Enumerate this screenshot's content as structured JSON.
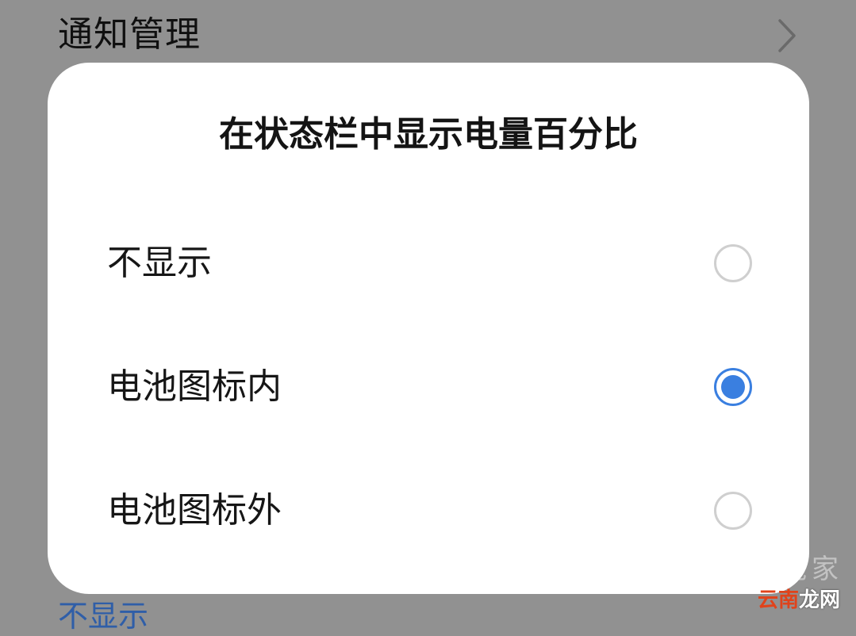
{
  "background": {
    "row_title": "通知管理",
    "value_text": "不显示"
  },
  "dialog": {
    "title": "在状态栏中显示电量百分比",
    "options": [
      {
        "label": "不显示",
        "selected": false
      },
      {
        "label": "电池图标内",
        "selected": true
      },
      {
        "label": "电池图标外",
        "selected": false
      }
    ],
    "accent_color": "#3a7fe0"
  },
  "watermark": {
    "top": "智能家",
    "bottom_part1": "云南",
    "bottom_part2": "龙网"
  }
}
